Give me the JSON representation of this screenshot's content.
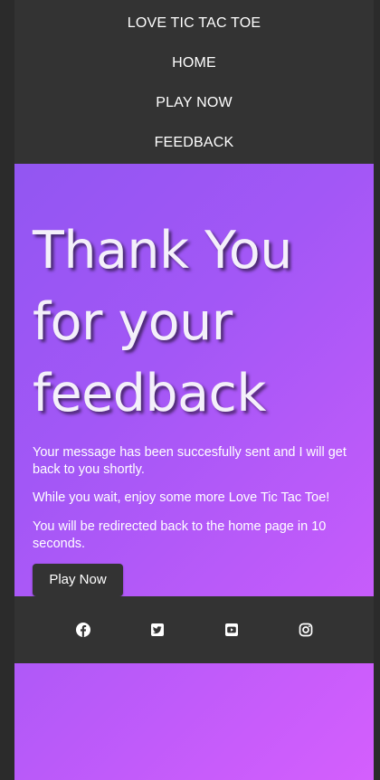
{
  "nav": {
    "brand": "LOVE TIC TAC TOE",
    "items": [
      {
        "label": "HOME"
      },
      {
        "label": "PLAY NOW"
      },
      {
        "label": "FEEDBACK"
      }
    ]
  },
  "hero": {
    "title_lines": [
      "Thank You",
      "for your",
      "feedback"
    ],
    "messages": [
      "Your message has been succesfully sent and I will get back to you shortly.",
      "While you wait, enjoy some more Love Tic Tac Toe!",
      "You will be redirected back to the home page in 10 seconds."
    ],
    "button_label": "Play Now"
  },
  "social": {
    "icons": [
      "facebook-icon",
      "twitter-icon",
      "youtube-icon",
      "instagram-icon"
    ]
  },
  "colors": {
    "nav_bg": "#333333",
    "gradient_start": "#8a55f0",
    "gradient_end": "#d45ffd",
    "text": "#ffffff"
  }
}
